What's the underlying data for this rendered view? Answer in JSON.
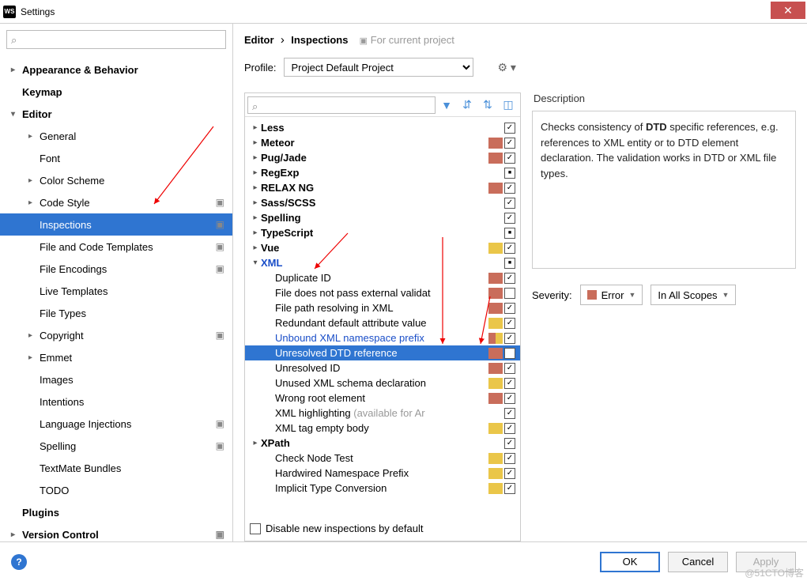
{
  "window": {
    "title": "Settings"
  },
  "sidebar": {
    "search_placeholder": "",
    "items": [
      {
        "label": "Appearance & Behavior",
        "bold": true,
        "arrow": ">",
        "level": 0
      },
      {
        "label": "Keymap",
        "bold": true,
        "arrow": "",
        "level": 0
      },
      {
        "label": "Editor",
        "bold": true,
        "arrow": "v",
        "level": 0
      },
      {
        "label": "General",
        "arrow": ">",
        "level": 1
      },
      {
        "label": "Font",
        "arrow": "",
        "level": 1
      },
      {
        "label": "Color Scheme",
        "arrow": ">",
        "level": 1
      },
      {
        "label": "Code Style",
        "arrow": ">",
        "level": 1,
        "proj": true
      },
      {
        "label": "Inspections",
        "arrow": "",
        "level": 1,
        "proj": true,
        "selected": true
      },
      {
        "label": "File and Code Templates",
        "arrow": "",
        "level": 1,
        "proj": true
      },
      {
        "label": "File Encodings",
        "arrow": "",
        "level": 1,
        "proj": true
      },
      {
        "label": "Live Templates",
        "arrow": "",
        "level": 1
      },
      {
        "label": "File Types",
        "arrow": "",
        "level": 1
      },
      {
        "label": "Copyright",
        "arrow": ">",
        "level": 1,
        "proj": true
      },
      {
        "label": "Emmet",
        "arrow": ">",
        "level": 1
      },
      {
        "label": "Images",
        "arrow": "",
        "level": 1
      },
      {
        "label": "Intentions",
        "arrow": "",
        "level": 1
      },
      {
        "label": "Language Injections",
        "arrow": "",
        "level": 1,
        "proj": true
      },
      {
        "label": "Spelling",
        "arrow": "",
        "level": 1,
        "proj": true
      },
      {
        "label": "TextMate Bundles",
        "arrow": "",
        "level": 1
      },
      {
        "label": "TODO",
        "arrow": "",
        "level": 1
      },
      {
        "label": "Plugins",
        "bold": true,
        "arrow": "",
        "level": 0
      },
      {
        "label": "Version Control",
        "bold": true,
        "arrow": ">",
        "level": 0,
        "proj": true
      }
    ]
  },
  "breadcrumb": {
    "part1": "Editor",
    "part2": "Inspections",
    "for_project": "For current project"
  },
  "profile": {
    "label": "Profile:",
    "value": "Project Default  Project"
  },
  "inspections": {
    "rows": [
      {
        "label": "Less",
        "bold": true,
        "arrow": ">",
        "sev": "",
        "chk": "checked"
      },
      {
        "label": "Meteor",
        "bold": true,
        "arrow": ">",
        "sev": "error",
        "chk": "checked"
      },
      {
        "label": "Pug/Jade",
        "bold": true,
        "arrow": ">",
        "sev": "error",
        "chk": "checked"
      },
      {
        "label": "RegExp",
        "bold": true,
        "arrow": ">",
        "sev": "",
        "chk": "mixed"
      },
      {
        "label": "RELAX NG",
        "bold": true,
        "arrow": ">",
        "sev": "error",
        "chk": "checked"
      },
      {
        "label": "Sass/SCSS",
        "bold": true,
        "arrow": ">",
        "sev": "",
        "chk": "checked"
      },
      {
        "label": "Spelling",
        "bold": true,
        "arrow": ">",
        "sev": "",
        "chk": "checked"
      },
      {
        "label": "TypeScript",
        "bold": true,
        "arrow": ">",
        "sev": "",
        "chk": "mixed"
      },
      {
        "label": "Vue",
        "bold": true,
        "arrow": ">",
        "sev": "warning",
        "chk": "checked"
      },
      {
        "label": "XML",
        "bold": true,
        "arrow": "v",
        "sev": "",
        "chk": "mixed",
        "link": true
      },
      {
        "label": "Duplicate ID",
        "level": 2,
        "sev": "error",
        "chk": "checked"
      },
      {
        "label": "File does not pass external validat",
        "level": 2,
        "sev": "error",
        "chk": ""
      },
      {
        "label": "File path resolving in XML",
        "level": 2,
        "sev": "error",
        "chk": "checked"
      },
      {
        "label": "Redundant default attribute value",
        "level": 2,
        "sev": "warning",
        "chk": "checked"
      },
      {
        "label": "Unbound XML namespace prefix",
        "level": 2,
        "sev": "mixed",
        "chk": "checked",
        "link": true
      },
      {
        "label": "Unresolved DTD reference",
        "level": 2,
        "sev": "error",
        "chk": "checked",
        "selected": true
      },
      {
        "label": "Unresolved ID",
        "level": 2,
        "sev": "error",
        "chk": "checked"
      },
      {
        "label": "Unused XML schema declaration",
        "level": 2,
        "sev": "warning",
        "chk": "checked"
      },
      {
        "label": "Wrong root element",
        "level": 2,
        "sev": "error",
        "chk": "checked"
      },
      {
        "label": "XML highlighting",
        "level": 2,
        "sev": "",
        "chk": "checked",
        "avail": "(available for Ar"
      },
      {
        "label": "XML tag empty body",
        "level": 2,
        "sev": "warning",
        "chk": "checked"
      },
      {
        "label": "XPath",
        "bold": true,
        "arrow": ">",
        "sev": "",
        "chk": "checked"
      },
      {
        "label": "Check Node Test",
        "level": 2,
        "sev": "warning",
        "chk": "checked"
      },
      {
        "label": "Hardwired Namespace Prefix",
        "level": 2,
        "sev": "warning",
        "chk": "checked"
      },
      {
        "label": "Implicit Type Conversion",
        "level": 2,
        "sev": "warning",
        "chk": "checked"
      }
    ],
    "disable_label": "Disable new inspections by default"
  },
  "description": {
    "label": "Description",
    "text_pre": "Checks consistency of ",
    "text_bold": "DTD",
    "text_post": " specific references, e.g. references to XML entity or to DTD element declaration. The validation works in DTD or XML file types."
  },
  "severity": {
    "label": "Severity:",
    "level": "Error",
    "scope": "In All Scopes"
  },
  "footer": {
    "ok": "OK",
    "cancel": "Cancel",
    "apply": "Apply"
  },
  "watermark": "@51CTO博客"
}
